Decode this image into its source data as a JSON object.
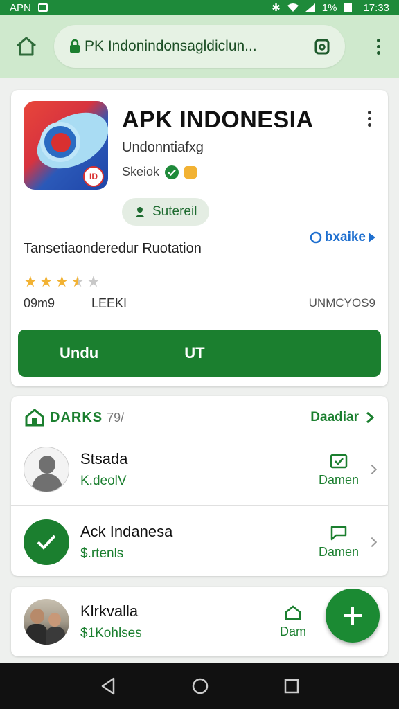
{
  "status_bar": {
    "left_text": "APN",
    "battery": "1%",
    "time": "17:33"
  },
  "browser": {
    "url": "PK Indonindonsagldiclun..."
  },
  "app": {
    "title": "APK INDONESIA",
    "subtitle": "Undonntiafxg",
    "meta": "Skeiok",
    "chip_label": "Sutereil",
    "description": "Tansetiaonderedur Ruotation",
    "more_link": "bxaike",
    "rating": 3.5,
    "stat_left": "09m9",
    "stat_mid": "LEEKI",
    "stat_right": "UNMCYOS9",
    "install_label_1": "Undu",
    "install_label_2": "UT"
  },
  "list": {
    "header_title": "DARKS",
    "header_count": "79/",
    "header_link": "Daadiar",
    "items": [
      {
        "name": "Stsada",
        "sub": "K.deolV",
        "action": "Damen"
      },
      {
        "name": "Ack Indanesa",
        "sub": "$.rtenls",
        "action": "Damen"
      },
      {
        "name": "Klrkvalla",
        "sub": "$1Kohlses",
        "action": "Dam"
      }
    ]
  },
  "colors": {
    "brand_green": "#1b7f2f",
    "status_green": "#1e8a3a",
    "browser_bg": "#cfe9cd",
    "star": "#f2b233",
    "link_blue": "#1e6fcf"
  }
}
